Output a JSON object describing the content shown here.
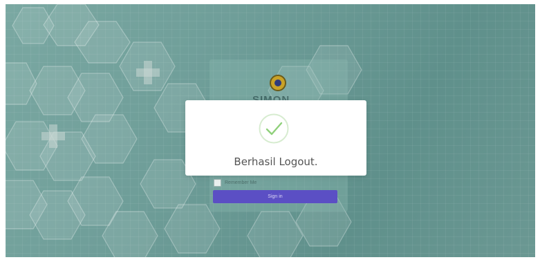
{
  "login": {
    "brand": "SIMON",
    "remember_label": "Remember Me",
    "signin_label": "Sign in"
  },
  "alert": {
    "title": "Berhasil Logout.",
    "icon": "success-check-icon",
    "accent_color": "#8fd07a"
  },
  "colors": {
    "background": "#6f9e99",
    "signin_button": "#5b4fc4"
  }
}
